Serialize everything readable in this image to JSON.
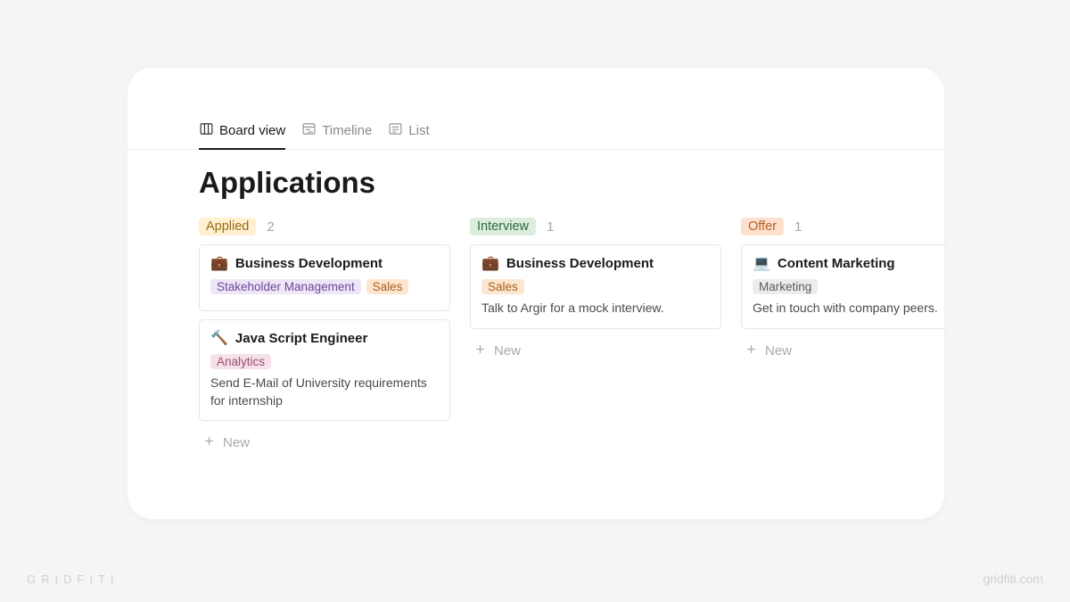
{
  "tabs": {
    "board": "Board view",
    "timeline": "Timeline",
    "list": "List"
  },
  "page_title": "Applications",
  "new_label": "New",
  "columns": [
    {
      "id": "applied",
      "label": "Applied",
      "count": "2",
      "badge_class": "badge-applied",
      "cards": [
        {
          "emoji": "💼",
          "title": "Business Development",
          "tags": [
            {
              "text": "Stakeholder Management",
              "cls": "tag-purple"
            },
            {
              "text": "Sales",
              "cls": "tag-orange"
            }
          ],
          "note": ""
        },
        {
          "emoji": "🔨",
          "title": "Java Script Engineer",
          "tags": [
            {
              "text": "Analytics",
              "cls": "tag-pink"
            }
          ],
          "note": "Send E-Mail of University requirements for internship"
        }
      ]
    },
    {
      "id": "interview",
      "label": "Interview",
      "count": "1",
      "badge_class": "badge-interview",
      "cards": [
        {
          "emoji": "💼",
          "title": "Business Development",
          "tags": [
            {
              "text": "Sales",
              "cls": "tag-orange"
            }
          ],
          "note": "Talk to Argir for a mock interview."
        }
      ]
    },
    {
      "id": "offer",
      "label": "Offer",
      "count": "1",
      "badge_class": "badge-offer",
      "cards": [
        {
          "emoji": "💻",
          "title": "Content Marketing",
          "tags": [
            {
              "text": "Marketing",
              "cls": "tag-gray"
            }
          ],
          "note": "Get in touch with company peers."
        }
      ]
    }
  ],
  "watermark": {
    "left": "GRIDFITI",
    "right": "gridfiti.com"
  }
}
